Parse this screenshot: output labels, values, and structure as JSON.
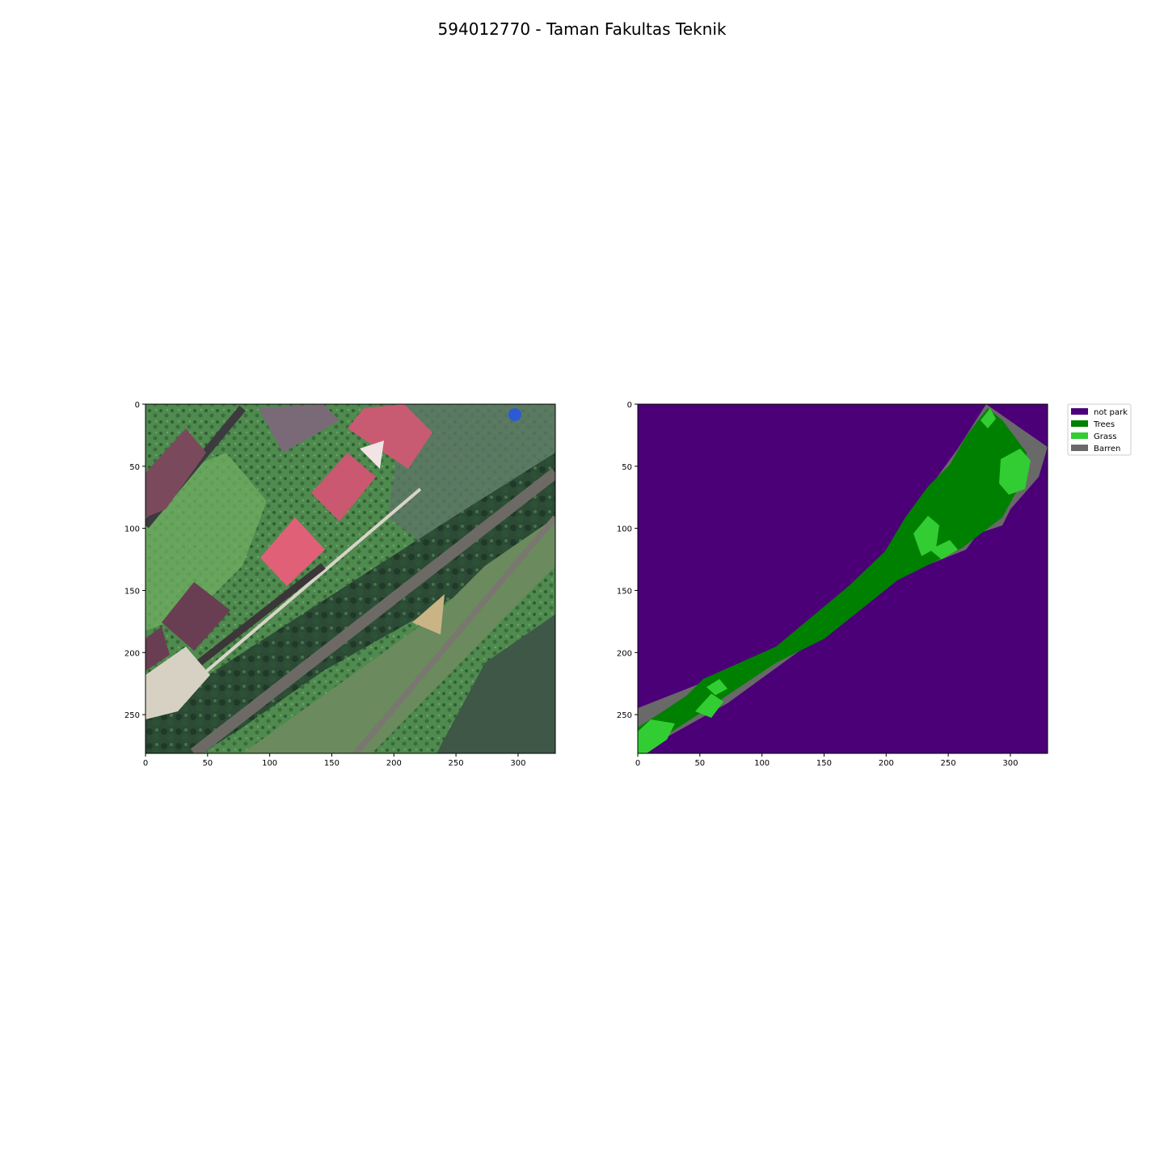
{
  "figure": {
    "title": "594012770 - Taman Fakultas Teknik"
  },
  "panels": {
    "left": {
      "kind": "satellite-image",
      "x_ticks": [
        "0",
        "50",
        "100",
        "150",
        "200",
        "250",
        "300"
      ],
      "y_ticks": [
        "0",
        "50",
        "100",
        "150",
        "200",
        "250"
      ]
    },
    "right": {
      "kind": "classification-map",
      "x_ticks": [
        "0",
        "50",
        "100",
        "150",
        "200",
        "250",
        "300"
      ],
      "y_ticks": [
        "0",
        "50",
        "100",
        "150",
        "200",
        "250"
      ]
    }
  },
  "legend": {
    "entries": [
      {
        "label": "not park",
        "color": "#4b0077"
      },
      {
        "label": "Trees",
        "color": "#008000"
      },
      {
        "label": "Grass",
        "color": "#32cd32"
      },
      {
        "label": "Barren",
        "color": "#696969"
      }
    ]
  },
  "colors": {
    "not_park": "#4b0077",
    "trees": "#008000",
    "grass": "#32cd32",
    "barren": "#696969"
  }
}
